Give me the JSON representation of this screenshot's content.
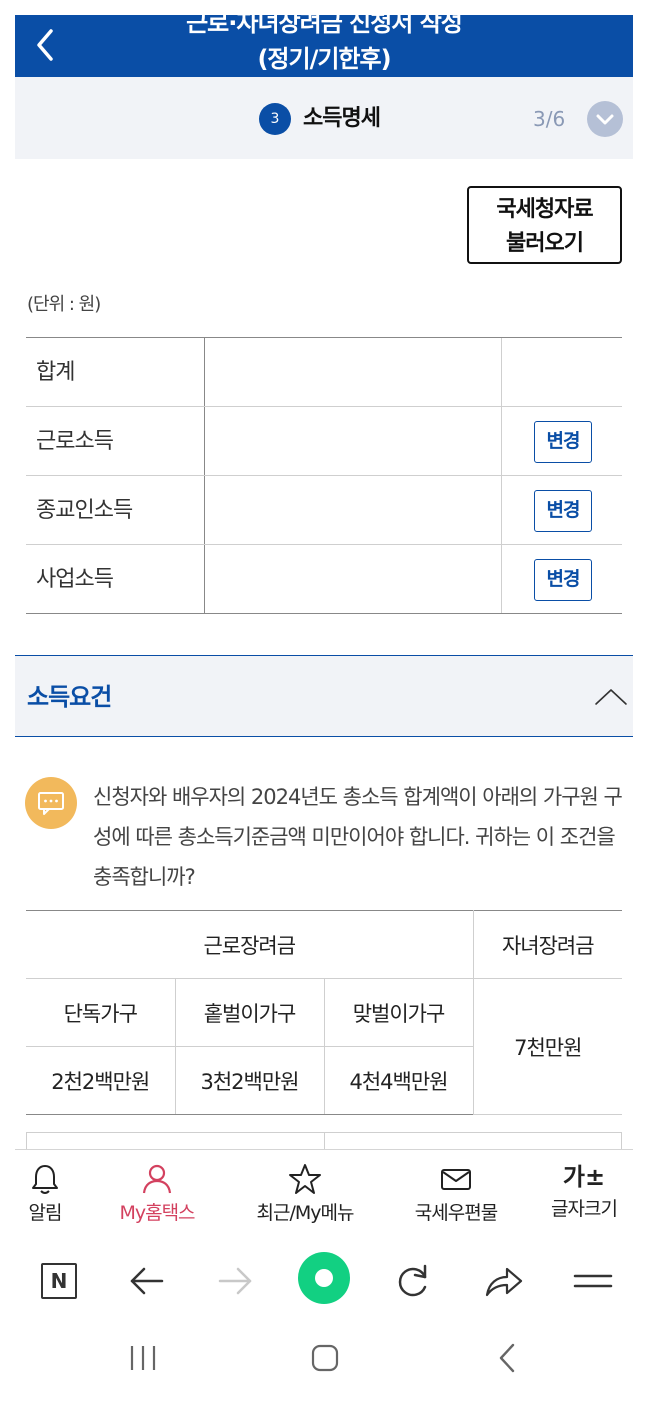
{
  "header": {
    "title_line1": "근로·자녀장려금 신청서 작성",
    "title_line2": "(정기/기한후)"
  },
  "step": {
    "number": "3",
    "title": "소득명세",
    "count": "3/6"
  },
  "fetch_button": {
    "line1": "국세청자료",
    "line2": "불러오기"
  },
  "unit": "(단위 : 원)",
  "income_rows": [
    {
      "label": "합계",
      "value": "",
      "button": ""
    },
    {
      "label": "근로소득",
      "value": "",
      "button": "변경"
    },
    {
      "label": "종교인소득",
      "value": "",
      "button": "변경"
    },
    {
      "label": "사업소득",
      "value": "",
      "button": "변경"
    }
  ],
  "section": {
    "title": "소득요건"
  },
  "notice": {
    "text": "신청자와 배우자의 2024년도 총소득 합계액이 아래의 가구원 구성에 따른 총소득기준금액 미만이어야 합니다. 귀하는 이 조건을 충족합니까?"
  },
  "criteria": {
    "earned_header": "근로장려금",
    "child_header": "자녀장려금",
    "columns": [
      "단독가구",
      "홑벌이가구",
      "맞벌이가구"
    ],
    "values": [
      "2천2백만원",
      "3천2백만원",
      "4천4백만원"
    ],
    "child_value": "7천만원"
  },
  "bottom_nav": [
    {
      "label": "알림",
      "icon": "bell-icon",
      "active": false
    },
    {
      "label": "My홈택스",
      "icon": "user-icon",
      "active": true
    },
    {
      "label": "최근/My메뉴",
      "icon": "star-icon",
      "active": false
    },
    {
      "label": "국세우편물",
      "icon": "mail-icon",
      "active": false
    },
    {
      "label": "글자크기",
      "icon": "font-size-icon",
      "glyph": "가±",
      "active": false
    }
  ],
  "browser_bar": {
    "n_label": "N"
  },
  "colors": {
    "primary": "#0a4ea6",
    "active_nav": "#d3415f",
    "notice_icon": "#f2b95c",
    "browser_home": "#12d082"
  }
}
